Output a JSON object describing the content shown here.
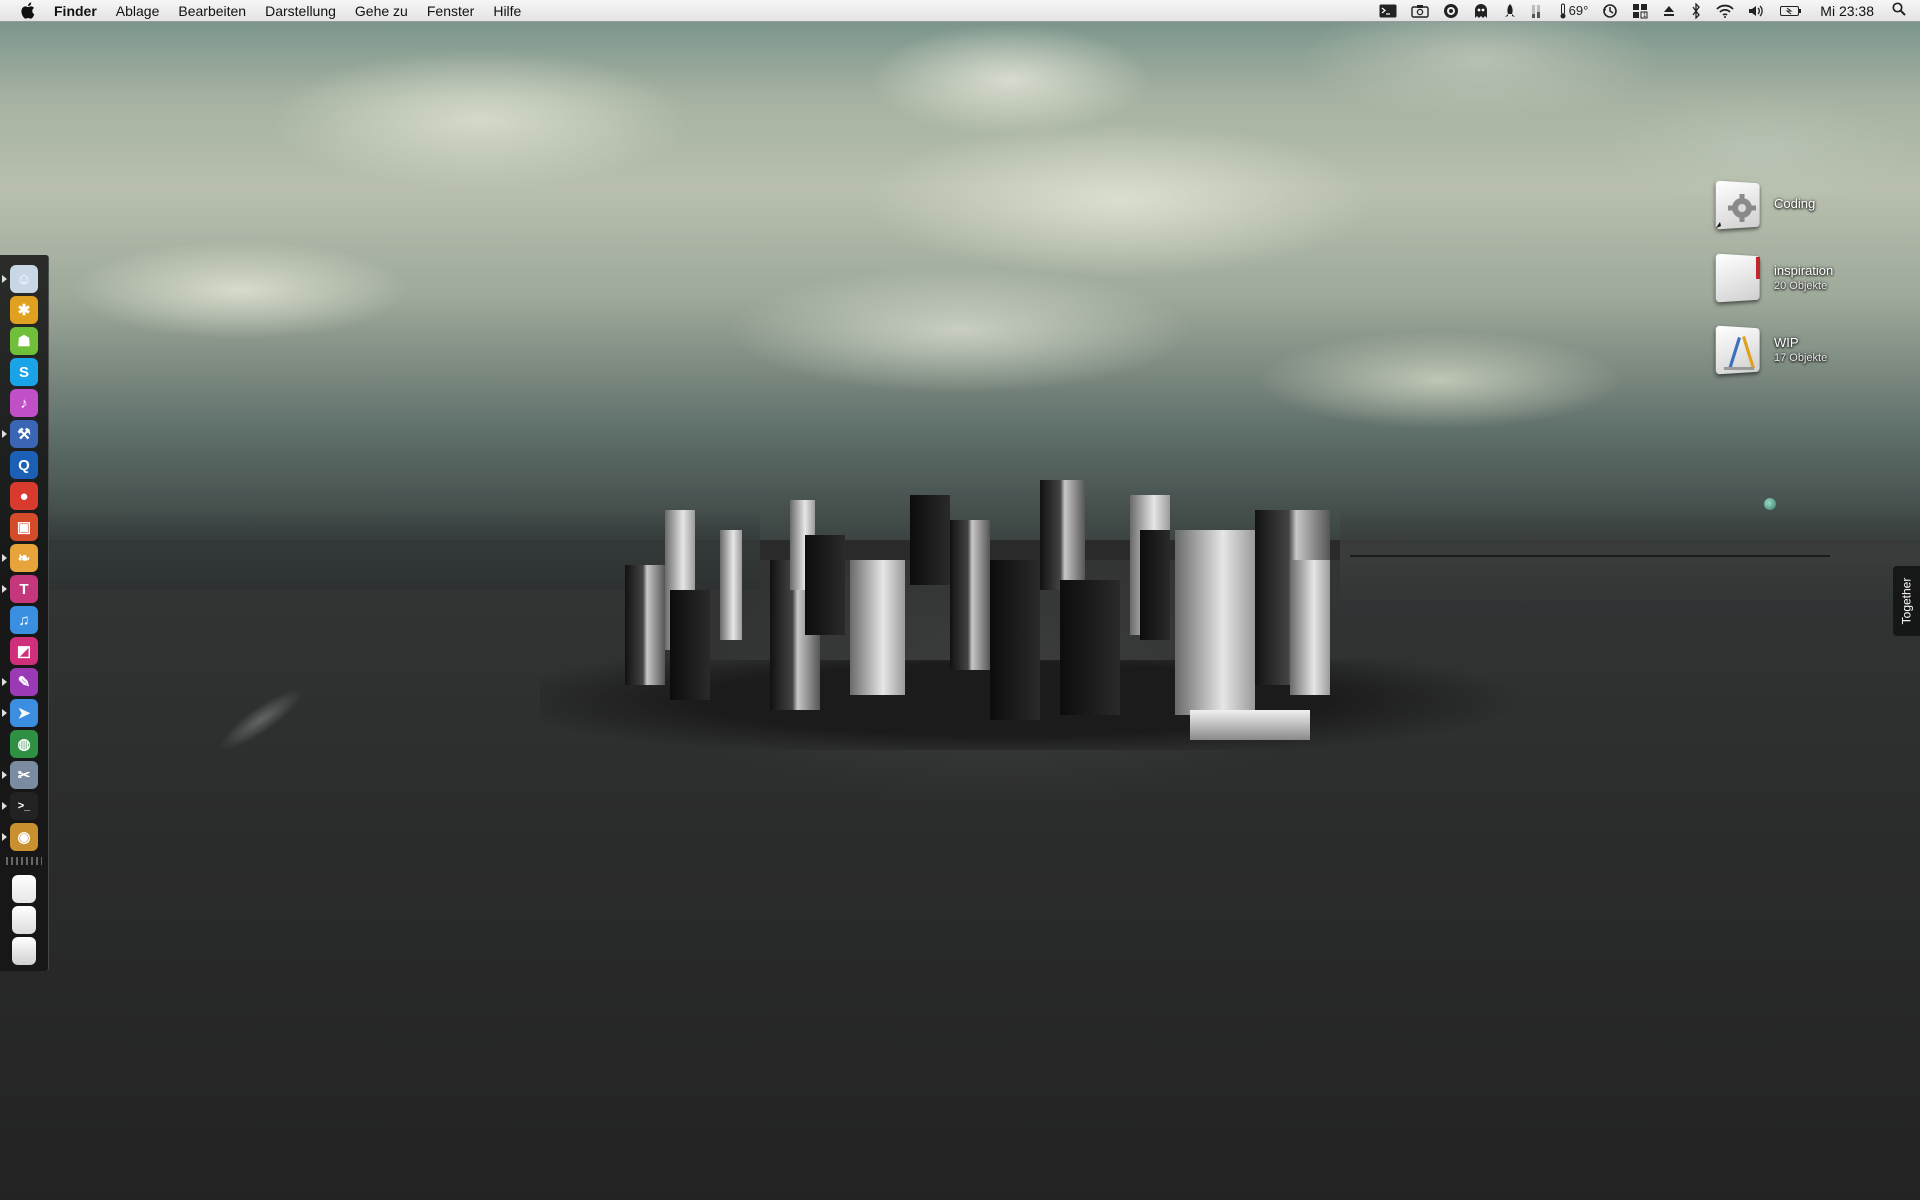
{
  "menubar": {
    "apple_icon": "apple-logo",
    "app_name": "Finder",
    "menus": [
      "Ablage",
      "Bearbeiten",
      "Darstellung",
      "Gehe zu",
      "Fenster",
      "Hilfe"
    ],
    "status": {
      "temperature": "69°",
      "clock": "Mi 23:38",
      "icons": [
        "terminal-icon",
        "camera-icon",
        "growl-icon",
        "ghost-icon",
        "rocket-icon",
        "cpu-meter-icon",
        "thermometer-icon",
        "time-machine-icon",
        "spaces-icon",
        "eject-icon",
        "bluetooth-icon",
        "wifi-icon",
        "volume-icon",
        "battery-icon",
        "spotlight-icon"
      ]
    }
  },
  "dock": {
    "items": [
      {
        "name": "finder",
        "icon": "finder-icon",
        "color": "#c8d6e6",
        "running": true
      },
      {
        "name": "adium",
        "icon": "bug-icon",
        "color": "#e0a020",
        "running": false
      },
      {
        "name": "android",
        "icon": "robot-icon",
        "color": "#6fbf3a",
        "running": false
      },
      {
        "name": "skype",
        "icon": "skype-icon",
        "color": "#1aa3e6",
        "running": false
      },
      {
        "name": "itunes-sparkle",
        "icon": "music-icon",
        "color": "#c04fc8",
        "running": false
      },
      {
        "name": "xcode",
        "icon": "hammer-icon",
        "color": "#3a66b5",
        "running": true
      },
      {
        "name": "quicksilver",
        "icon": "q-icon",
        "color": "#1b5fb6",
        "running": false
      },
      {
        "name": "chrome-dev",
        "icon": "red-circle-icon",
        "color": "#d83a2e",
        "running": false
      },
      {
        "name": "pixel-app",
        "icon": "pixel-icon",
        "color": "#d44b2a",
        "running": false
      },
      {
        "name": "coda",
        "icon": "leaf-icon",
        "color": "#e6a43a",
        "running": true
      },
      {
        "name": "textmate",
        "icon": "t-icon",
        "color": "#c4377a",
        "running": true
      },
      {
        "name": "itunes",
        "icon": "note-icon",
        "color": "#3a8fe0",
        "running": false
      },
      {
        "name": "photo-app",
        "icon": "photo-icon",
        "color": "#d0307a",
        "running": false
      },
      {
        "name": "photoshop-like",
        "icon": "brush-icon",
        "color": "#9b3ab5",
        "running": true
      },
      {
        "name": "transmit",
        "icon": "truck-icon",
        "color": "#3b8ee0",
        "running": true
      },
      {
        "name": "safari",
        "icon": "globe-icon",
        "color": "#2f8f43",
        "running": false
      },
      {
        "name": "utilities",
        "icon": "wrench-icon",
        "color": "#7b8ca0",
        "running": true
      },
      {
        "name": "terminal",
        "icon": "terminal-icon",
        "color": "#222222",
        "running": true
      },
      {
        "name": "preview",
        "icon": "camera-photo-icon",
        "color": "#c8902e",
        "running": true
      }
    ],
    "stacks": [
      {
        "name": "documents",
        "icon": "drive-icon",
        "color": "#e6e6e6"
      },
      {
        "name": "downloads",
        "icon": "document-icon",
        "color": "#dcdcdc"
      },
      {
        "name": "trash",
        "icon": "trash-icon",
        "color": "#d0d0d0"
      }
    ]
  },
  "desktop": {
    "icons": [
      {
        "label": "Coding",
        "sub": "",
        "icon": "gear-document-icon"
      },
      {
        "label": "inspiration",
        "sub": "20 Objekte",
        "icon": "red-bookmark-document-icon"
      },
      {
        "label": "WIP",
        "sub": "17 Objekte",
        "icon": "pencil-ruler-document-icon"
      }
    ],
    "side_tab": "Together"
  }
}
